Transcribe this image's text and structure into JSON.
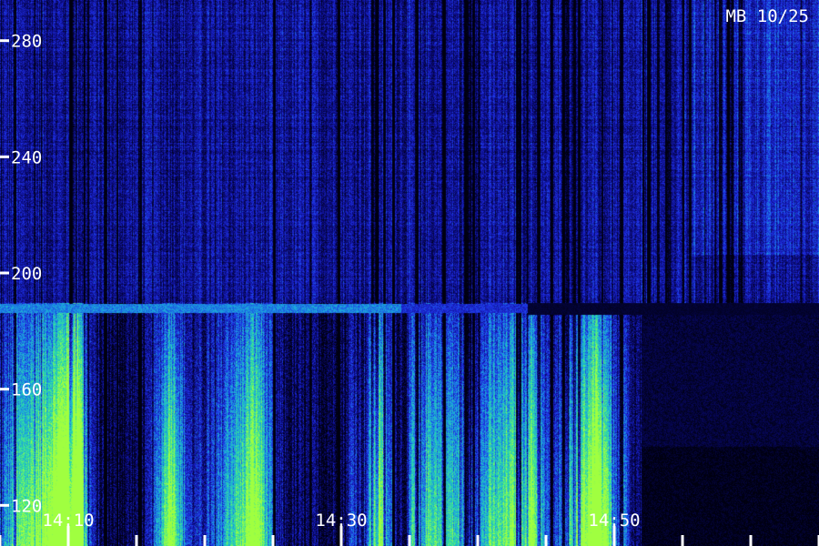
{
  "chart_data": {
    "type": "heatmap",
    "title": "MB 10/25",
    "xlabel": "",
    "ylabel": "",
    "x_tick_labels": [
      "14:10",
      "14:30",
      "14:50"
    ],
    "y_tick_labels": [
      "280",
      "240",
      "200",
      "160",
      "120"
    ],
    "y_ticks": [
      280,
      240,
      200,
      160,
      120
    ],
    "ylim": [
      106,
      294
    ],
    "time_range": [
      "14:05",
      "15:05"
    ],
    "grid": false,
    "colormap": [
      "#000010",
      "#0a0a7a",
      "#1f2ee6",
      "#1aa3e0",
      "#30e0a0",
      "#a0ff40"
    ],
    "features": {
      "horizontal_band_freq": 188,
      "strong_emission_freq_range": [
        106,
        190
      ],
      "quiet_after_time": "14:52"
    }
  }
}
